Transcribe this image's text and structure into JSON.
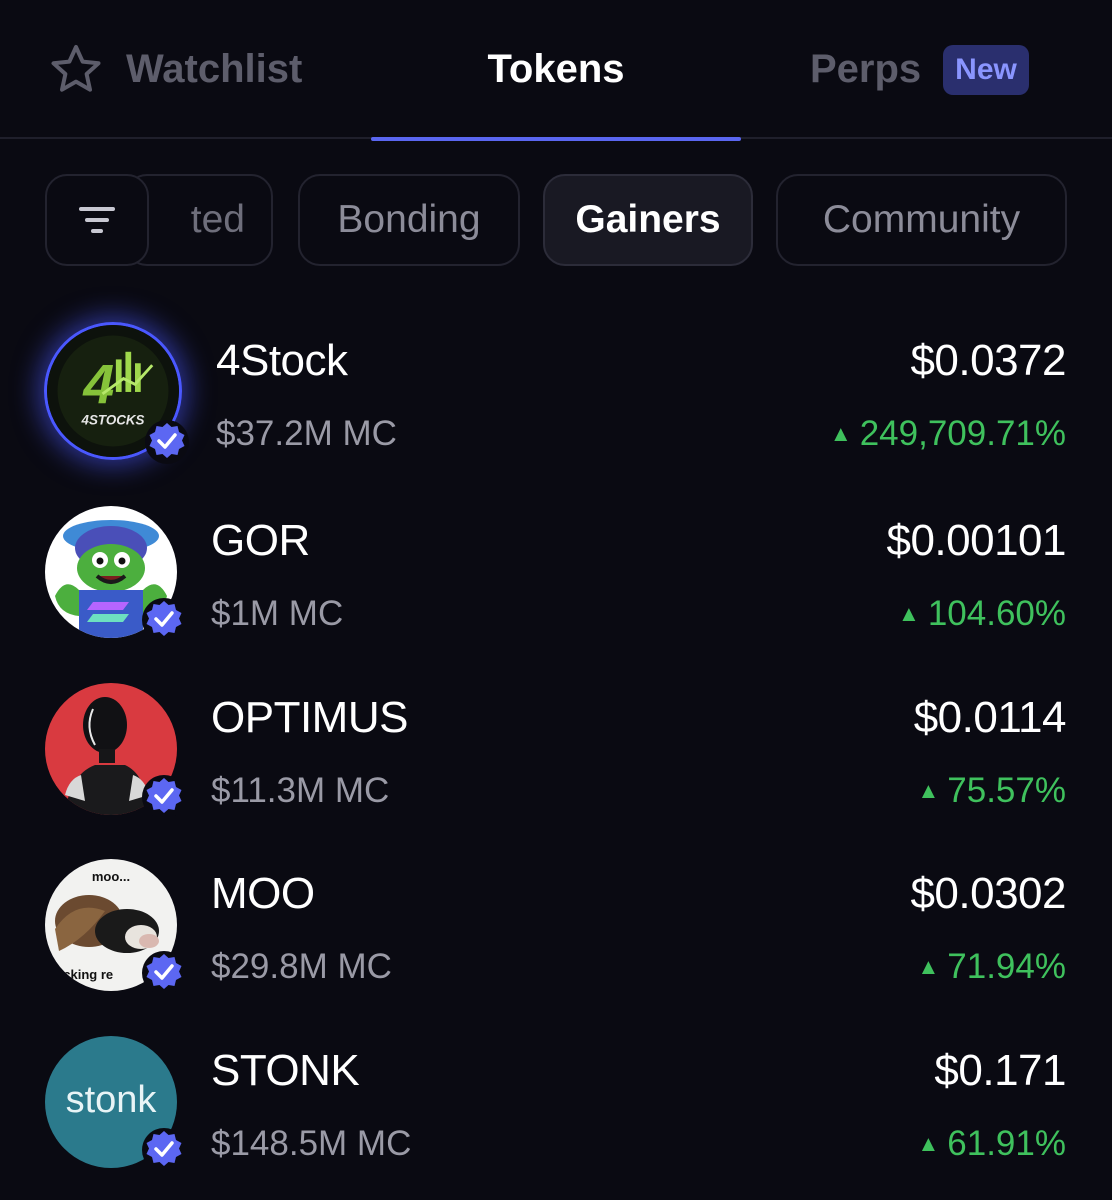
{
  "tabs": {
    "watchlist": "Watchlist",
    "tokens": "Tokens",
    "perps": "Perps",
    "perps_badge": "New"
  },
  "chips": {
    "partial": "ted",
    "bonding": "Bonding",
    "gainers": "Gainers",
    "community": "Community"
  },
  "tokens": [
    {
      "name": "4Stock",
      "mc": "$37.2M MC",
      "price": "$0.0372",
      "change": "249,709.71%",
      "avatar_text": "4STOCKS"
    },
    {
      "name": "GOR",
      "mc": "$1M MC",
      "price": "$0.00101",
      "change": "104.60%"
    },
    {
      "name": "OPTIMUS",
      "mc": "$11.3M MC",
      "price": "$0.0114",
      "change": "75.57%"
    },
    {
      "name": "MOO",
      "mc": "$29.8M MC",
      "price": "$0.0302",
      "change": "71.94%",
      "avatar_text_top": "moo...",
      "avatar_text_bottom": "fucking re"
    },
    {
      "name": "STONK",
      "mc": "$148.5M MC",
      "price": "$0.171",
      "change": "61.91%",
      "avatar_text": "stonk"
    }
  ],
  "colors": {
    "background": "#0a0a12",
    "accent": "#5a66f0",
    "positive": "#3fc15d",
    "muted": "#9a9aa6"
  },
  "icons": {
    "watchlist": "star-icon",
    "filter": "filter-icon",
    "verified": "verified-badge-icon",
    "up": "triangle-up-icon"
  }
}
